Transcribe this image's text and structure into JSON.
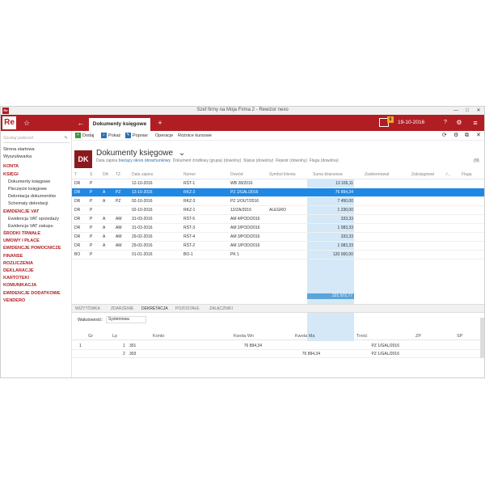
{
  "window": {
    "app_icon": "Re",
    "title": "Szef firmy na Moja Firma 2 - Rewizor nexo",
    "min": "—",
    "max": "□",
    "close": "✕"
  },
  "topbar": {
    "logo": "Re",
    "star_icon": "☆",
    "back_icon": "←",
    "active_tab": "Dokumenty księgowe",
    "add_icon": "+",
    "notification_count": "6",
    "date": "19-10-2016",
    "help_icon": "?",
    "settings_icon": "⚙",
    "menu_icon": "≡"
  },
  "sidebar": {
    "search_placeholder": "Szukaj poleceń",
    "pin_icon": "✎",
    "items": [
      {
        "label": "Strona startowa",
        "style": "plain"
      },
      {
        "label": "Wyszukiwarka",
        "style": "plain"
      },
      {
        "label": "KONTA",
        "style": "red"
      },
      {
        "label": "KSIĘGI",
        "style": "red"
      },
      {
        "label": "Dokumenty księgowe",
        "style": "sub"
      },
      {
        "label": "Pieczęcie księgowe",
        "style": "sub"
      },
      {
        "label": "Dekretacja dokumentów",
        "style": "sub"
      },
      {
        "label": "Schematy dekretacji",
        "style": "sub"
      },
      {
        "label": "EWIDENCJE VAT",
        "style": "red"
      },
      {
        "label": "Ewidencja VAT sprzedaży",
        "style": "sub"
      },
      {
        "label": "Ewidencja VAT zakupu",
        "style": "sub"
      },
      {
        "label": "ŚRODKI TRWAŁE",
        "style": "red"
      },
      {
        "label": "UMOWY I PŁACE",
        "style": "red"
      },
      {
        "label": "EWIDENCJE POMOCNICZE",
        "style": "red"
      },
      {
        "label": "FINANSE",
        "style": "red"
      },
      {
        "label": "ROZLICZENIA",
        "style": "red"
      },
      {
        "label": "DEKLARACJE",
        "style": "red"
      },
      {
        "label": "KARTOTEKI",
        "style": "red"
      },
      {
        "label": "KOMUNIKACJA",
        "style": "red"
      },
      {
        "label": "EWIDENCJE DODATKOWE",
        "style": "red"
      },
      {
        "label": "VENDERO",
        "style": "red"
      }
    ]
  },
  "toolbar": {
    "add": "Dodaj",
    "show": "Pokaż",
    "edit": "Popraw",
    "operations": "Operacje",
    "exchange_diff": "Różnice kursowe",
    "refresh_icon": "⟳",
    "settings_icon": "⚙",
    "window_icon": "⧉",
    "close_icon": "✕"
  },
  "header": {
    "badge": "DK",
    "title": "Dokumenty księgowe",
    "dropdown_icon": "⌄",
    "filter_date_label": "Data zapisu",
    "filter_date_value": "bieżący okres obrachunkowy",
    "filter_source": "Dokument źródłowy (grupa) (dowolny)",
    "filter_status": "Status (dowolny)",
    "filter_register": "Rejestr (dowolny)",
    "filter_flag": "Flaga (dowolna)",
    "count": "(9)"
  },
  "table": {
    "columns": [
      "T",
      "S",
      "DA",
      "TZ",
      "Data zapisu",
      "Numer",
      "Dowód",
      "Symbol klienta",
      "Suma bilansowa",
      "Zadekretował",
      "Zaksięgował",
      "√...",
      "Flaga"
    ],
    "rows": [
      [
        "DR",
        "P",
        "",
        "",
        "12-10-2016",
        "RŚT-1",
        "WB 28/2016",
        "",
        "13 165,11",
        "",
        "",
        "",
        ""
      ],
      [
        "DR",
        "P",
        "A",
        "PZ",
        "12-10-2016",
        "RKZ-2",
        "PZ 1/GAL/2016",
        "",
        "76 894,34",
        "",
        "",
        "",
        ""
      ],
      [
        "DR",
        "P",
        "A",
        "PZ",
        "02-10-2016",
        "RKZ-3",
        "PZ 1/OUT/2016",
        "",
        "7 450,00",
        "",
        "",
        "",
        ""
      ],
      [
        "DR",
        "P",
        "",
        "",
        "02-10-2016",
        "RKZ-1",
        "12/ZA/2016",
        "ALEGRO",
        "1 230,00",
        "",
        "",
        "",
        ""
      ],
      [
        "DR",
        "P",
        "A",
        "AM",
        "31-03-2016",
        "RŚT-5",
        "AM 4/POD/2016",
        "",
        "333,33",
        "",
        "",
        "",
        ""
      ],
      [
        "DR",
        "P",
        "A",
        "AM",
        "31-03-2016",
        "RŚT-3",
        "AM 2/POD/2016",
        "",
        "1 083,33",
        "",
        "",
        "",
        ""
      ],
      [
        "DR",
        "P",
        "A",
        "AM",
        "29-02-2016",
        "RŚT-4",
        "AM 3/POD/2016",
        "",
        "333,33",
        "",
        "",
        "",
        ""
      ],
      [
        "DR",
        "P",
        "A",
        "AM",
        "29-02-2016",
        "RŚT-2",
        "AM 1/POD/2016",
        "",
        "1 083,33",
        "",
        "",
        "",
        ""
      ],
      [
        "BO",
        "P",
        "",
        "",
        "01-01-2016",
        "BO-1",
        "PK 1",
        "",
        "120 000,00",
        "",
        "",
        "",
        ""
      ]
    ],
    "selected_row": 1,
    "sum_total": "221 572,77"
  },
  "bottom_tabs": [
    "WIZYTÓWKA",
    "ZDARZENIE",
    "DEKRETACJA",
    "POZOSTAŁE",
    "ZAŁĄCZNIKI"
  ],
  "bottom_active_tab": 2,
  "detail": {
    "currency_label": "Walutowość:",
    "currency_value": "Systemowa",
    "columns": [
      "Gr",
      "Lp",
      "Konto",
      "Kwota Wn",
      "Kwota Ma",
      "Treść",
      "ZP",
      "SP"
    ],
    "rows": [
      [
        "1",
        "1",
        "301",
        "76 894,34",
        "",
        "PZ 1/GAL/2016",
        "",
        ""
      ],
      [
        "",
        "2",
        "303",
        "",
        "76 894,34",
        "PZ 1/GAL/2016",
        "",
        ""
      ]
    ]
  },
  "colors": {
    "brand_red": "#b01e24",
    "selection_blue": "#1e88e5",
    "sum_column": "#d4e8f7"
  }
}
